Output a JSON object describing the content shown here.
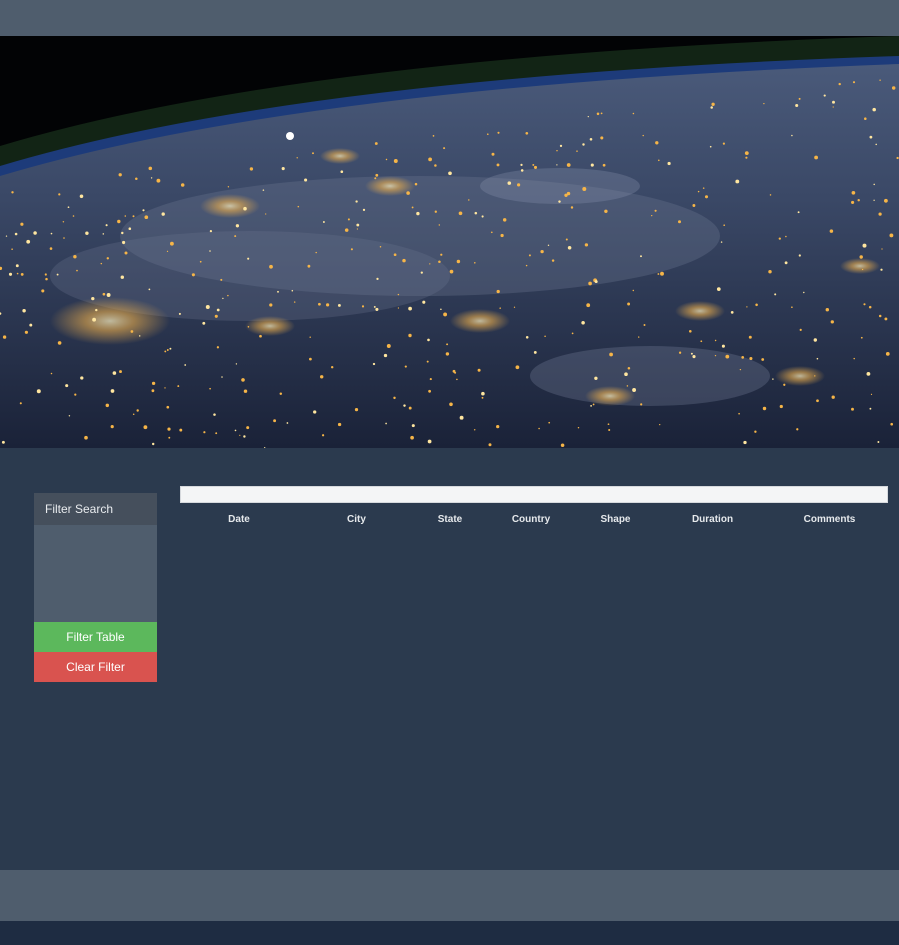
{
  "hero": {
    "image": "earth-at-night-from-space"
  },
  "filter": {
    "header": "Filter Search",
    "filter_button": "Filter Table",
    "clear_button": "Clear Filter"
  },
  "table": {
    "columns": [
      "Date",
      "City",
      "State",
      "Country",
      "Shape",
      "Duration",
      "Comments"
    ],
    "rows": []
  },
  "colors": {
    "background": "#2b3a4e",
    "bar": "#4f5d6d",
    "filter_green": "#5cb85c",
    "clear_red": "#d9534f"
  }
}
